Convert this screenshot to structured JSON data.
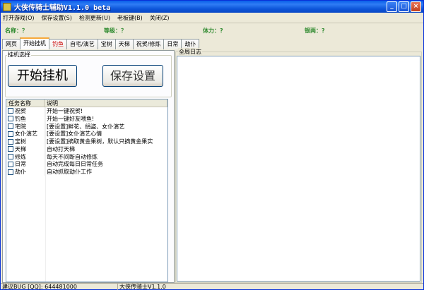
{
  "window": {
    "title": "大侠传骑士辅助V1.1.0 beta",
    "buttons": [
      "_",
      "□",
      "×"
    ]
  },
  "menu": [
    "打开游戏(O)",
    "保存设置(S)",
    "检测更新(U)",
    "老板键(B)",
    "关闭(Z)"
  ],
  "info": {
    "name_label": "名称：？",
    "level_label": "等级：？",
    "stamina_label": "体力：?",
    "silver_label": "银两：?"
  },
  "tabs": [
    "网页",
    "开始挂机",
    "钓鱼",
    "自宅/演艺",
    "宝树",
    "天梯",
    "祝贺/修炼",
    "日常",
    "劫仆"
  ],
  "panel": {
    "group_label": "挂机选择",
    "start_button": "开始挂机",
    "save_button": "保存设置"
  },
  "task_list": {
    "headers": [
      "任务名称",
      "说明"
    ],
    "rows": [
      {
        "name": "祝贺",
        "desc": "开始一键祝贺!"
      },
      {
        "name": "钓鱼",
        "desc": "开始一键好友喂鱼!"
      },
      {
        "name": "宅院",
        "desc": "[要设置]鲜花、绢盗、女仆演艺"
      },
      {
        "name": "女仆演艺",
        "desc": "[要设置]女仆演艺心情"
      },
      {
        "name": "宝树",
        "desc": "[要设置]摘取黄金果树，默认只摘黄金果实"
      },
      {
        "name": "天梯",
        "desc": "自动打天梯"
      },
      {
        "name": "修炼",
        "desc": "每天不间断自动修炼"
      },
      {
        "name": "日常",
        "desc": "自动完成每日日常任务"
      },
      {
        "name": "劫仆",
        "desc": "自动抓取劫仆工作"
      }
    ]
  },
  "log": {
    "label": "全局日志"
  },
  "status": {
    "left": "建议BUG [QQ]: 644481000",
    "right": "大侠传骑士V1.1.0"
  }
}
